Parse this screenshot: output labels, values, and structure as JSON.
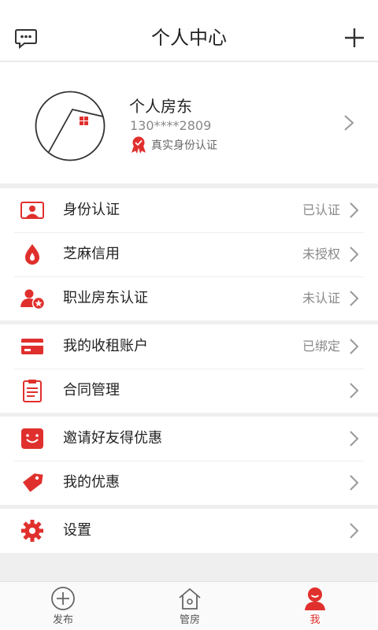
{
  "header": {
    "title": "个人中心"
  },
  "profile": {
    "name": "个人房东",
    "phone": "130****2809",
    "verify_text": "真实身份认证"
  },
  "groups": [
    {
      "items": [
        {
          "label": "身份认证",
          "status": "已认证",
          "icon": "id-card-icon"
        },
        {
          "label": "芝麻信用",
          "status": "未授权",
          "icon": "sesame-credit-icon"
        },
        {
          "label": "职业房东认证",
          "status": "未认证",
          "icon": "landlord-badge-icon"
        }
      ]
    },
    {
      "items": [
        {
          "label": "我的收租账户",
          "status": "已绑定",
          "icon": "bank-card-icon"
        },
        {
          "label": "合同管理",
          "status": "",
          "icon": "clipboard-icon"
        }
      ]
    },
    {
      "items": [
        {
          "label": "邀请好友得优惠",
          "status": "",
          "icon": "gift-bag-icon"
        },
        {
          "label": "我的优惠",
          "status": "",
          "icon": "coupon-tag-icon"
        }
      ]
    },
    {
      "items": [
        {
          "label": "设置",
          "status": "",
          "icon": "gear-icon"
        }
      ]
    }
  ],
  "tabbar": {
    "tabs": [
      {
        "label": "发布",
        "icon": "publish-plus-icon",
        "active": false
      },
      {
        "label": "管房",
        "icon": "house-icon",
        "active": false
      },
      {
        "label": "我",
        "icon": "profile-icon",
        "active": true
      }
    ]
  },
  "colors": {
    "accent": "#e0302d",
    "text": "#222222",
    "muted": "#888888",
    "background": "#efefef"
  }
}
